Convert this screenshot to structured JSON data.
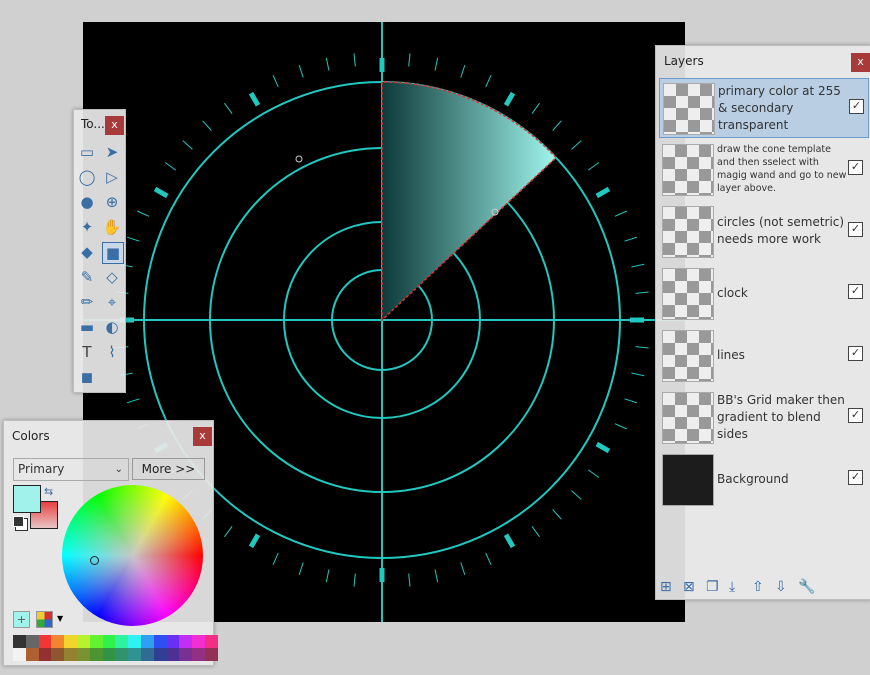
{
  "tools_window": {
    "title": "To...",
    "close": "x",
    "tools": [
      {
        "name": "rectangle-select",
        "glyph": "▭"
      },
      {
        "name": "move-selected",
        "glyph": "➤"
      },
      {
        "name": "lasso-select",
        "glyph": "◯"
      },
      {
        "name": "move-selection",
        "glyph": "▷"
      },
      {
        "name": "ellipse-select",
        "glyph": "●"
      },
      {
        "name": "zoom",
        "glyph": "⊕"
      },
      {
        "name": "magic-wand",
        "glyph": "✦"
      },
      {
        "name": "pan",
        "glyph": "✋"
      },
      {
        "name": "paint-bucket",
        "glyph": "◆"
      },
      {
        "name": "gradient",
        "glyph": "■"
      },
      {
        "name": "paintbrush",
        "glyph": "✎"
      },
      {
        "name": "eraser",
        "glyph": "◇"
      },
      {
        "name": "pencil",
        "glyph": "✏"
      },
      {
        "name": "color-picker",
        "glyph": "⌖"
      },
      {
        "name": "clone-stamp",
        "glyph": "▬"
      },
      {
        "name": "recolor",
        "glyph": "◐"
      },
      {
        "name": "text",
        "glyph": "T"
      },
      {
        "name": "line-curve",
        "glyph": "⌇"
      },
      {
        "name": "shapes",
        "glyph": "◼"
      }
    ]
  },
  "colors_window": {
    "title": "Colors",
    "close": "x",
    "mode_select": "Primary",
    "more_button": "More >>",
    "primary_color": "#a0f2ea",
    "secondary_color": "#e84040",
    "palette_row1": [
      "#333333",
      "#666666",
      "#f23535",
      "#f2852f",
      "#f2d42f",
      "#b8f22f",
      "#62f22f",
      "#2ff24a",
      "#2ff2a0",
      "#2ff2f2",
      "#2f9ff2",
      "#2f4ff2",
      "#6a2ff2",
      "#c02ff2",
      "#f22fd2",
      "#f22f85"
    ],
    "palette_row2": [
      "#f2f2f2",
      "#b06030",
      "#933030",
      "#8d5530",
      "#938330",
      "#789330",
      "#4d9330",
      "#309345",
      "#30936b",
      "#309393",
      "#306b93",
      "#303f93",
      "#4e3093",
      "#783093",
      "#933082",
      "#933058"
    ]
  },
  "layers_window": {
    "title": "Layers",
    "close": "x",
    "layers": [
      {
        "name": "primary color at 255 & secondary transparent",
        "visible": true,
        "selected": true
      },
      {
        "name": "draw the cone template and then sselect with magig wand and go to new layer above.",
        "visible": true,
        "selected": false
      },
      {
        "name": "circles (not semetric) needs more work",
        "visible": true,
        "selected": false
      },
      {
        "name": "clock",
        "visible": true,
        "selected": false
      },
      {
        "name": "lines",
        "visible": true,
        "selected": false
      },
      {
        "name": "BB's Grid maker then gradient to blend sides",
        "visible": true,
        "selected": false
      },
      {
        "name": "Background",
        "visible": true,
        "selected": false
      }
    ],
    "toolbar": [
      "add-layer",
      "delete-layer",
      "duplicate-layer",
      "merge-layer-down",
      "move-layer-up",
      "move-layer-down",
      "layer-properties"
    ]
  },
  "canvas": {
    "accent": "#22c8c0",
    "cone_color": "#a0f5ec"
  }
}
